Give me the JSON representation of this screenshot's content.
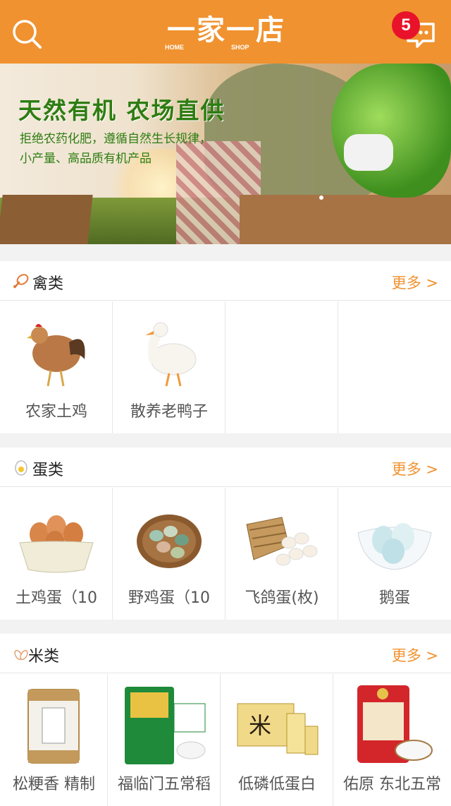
{
  "header": {
    "logo_text": "一家一店",
    "logo_sub_left": "HOME",
    "logo_sub_right": "SHOP",
    "badge_count": "5",
    "icons": [
      "search-icon",
      "message-icon"
    ],
    "color": "#f0922f"
  },
  "banner": {
    "title": "天然有机 农场直供",
    "line1": "拒绝农药化肥，遵循自然生长规律，",
    "line2": "小产量、高品质有机产品"
  },
  "sections": [
    {
      "title": "禽类",
      "more": "更多 >",
      "icon": "drumstick-icon",
      "items": [
        {
          "name": "农家土鸡"
        },
        {
          "name": "散养老鸭子"
        }
      ]
    },
    {
      "title": "蛋类",
      "more": "更多 >",
      "icon": "egg-icon",
      "items": [
        {
          "name": "土鸡蛋（10"
        },
        {
          "name": "野鸡蛋（10"
        },
        {
          "name": "飞鸽蛋(枚)"
        },
        {
          "name": "鹅蛋"
        }
      ]
    },
    {
      "title": "米类",
      "more": "更多 >",
      "icon": "rice-icon",
      "items": [
        {
          "name": "松粳香 精制"
        },
        {
          "name": "福临门五常稻"
        },
        {
          "name": "低磷低蛋白"
        },
        {
          "name": "佑原 东北五常"
        }
      ]
    }
  ]
}
